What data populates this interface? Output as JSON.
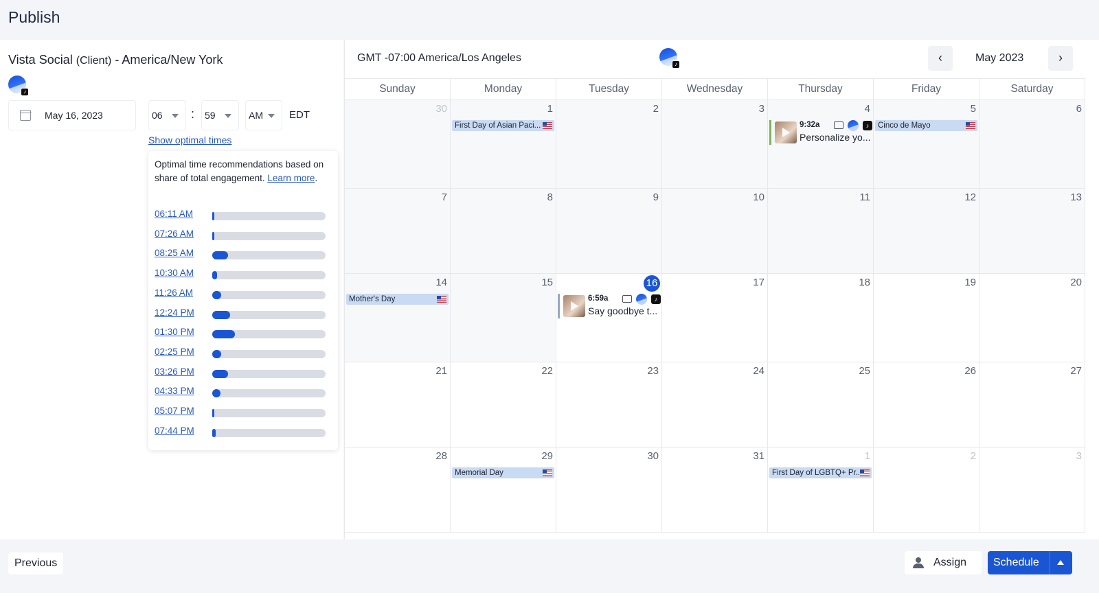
{
  "header": {
    "title": "Publish"
  },
  "left": {
    "account": "Vista Social",
    "account_tag": "(Client)",
    "account_tz": "- America/New York",
    "date": "May 16, 2023",
    "hour": "06",
    "minute": "59",
    "ampm": "AM",
    "tz_abbr": "EDT",
    "optimal_link": "Show optimal times",
    "popup": {
      "desc": "Optimal time recommendations based on share of total engagement.",
      "learn_more": "Learn more",
      "times": [
        {
          "label": "06:11 AM",
          "share": 0.01
        },
        {
          "label": "07:26 AM",
          "share": 0.02
        },
        {
          "label": "08:25 AM",
          "share": 0.14
        },
        {
          "label": "10:30 AM",
          "share": 0.04
        },
        {
          "label": "11:26 AM",
          "share": 0.08
        },
        {
          "label": "12:24 PM",
          "share": 0.16
        },
        {
          "label": "01:30 PM",
          "share": 0.2
        },
        {
          "label": "02:25 PM",
          "share": 0.08
        },
        {
          "label": "03:26 PM",
          "share": 0.14
        },
        {
          "label": "04:33 PM",
          "share": 0.07
        },
        {
          "label": "05:07 PM",
          "share": 0.02
        },
        {
          "label": "07:44 PM",
          "share": 0.03
        }
      ]
    }
  },
  "calendar": {
    "timezone": "GMT -07:00 America/Los Angeles",
    "month": "May 2023",
    "prev": "‹",
    "next": "›",
    "days": [
      "Sunday",
      "Monday",
      "Tuesday",
      "Wednesday",
      "Thursday",
      "Friday",
      "Saturday"
    ],
    "weeks": [
      [
        "30",
        "1",
        "2",
        "3",
        "4",
        "5",
        "6"
      ],
      [
        "7",
        "8",
        "9",
        "10",
        "11",
        "12",
        "13"
      ],
      [
        "14",
        "15",
        "16",
        "17",
        "18",
        "19",
        "20"
      ],
      [
        "21",
        "22",
        "23",
        "24",
        "25",
        "26",
        "27"
      ],
      [
        "28",
        "29",
        "30",
        "31",
        "1",
        "2",
        "3"
      ]
    ],
    "holidays": {
      "monday_1": "First Day of Asian Paci...",
      "friday_5": "Cinco de Mayo",
      "sunday_14": "Mother's Day",
      "monday_29": "Memorial Day",
      "thursday_1": "First Day of LGBTQ+ Pr..."
    },
    "posts": {
      "thursday_4": {
        "time": "9:32a",
        "text": "Personalize yo..."
      },
      "tuesday_16": {
        "time": "6:59a",
        "text": "Say goodbye t..."
      }
    }
  },
  "footer": {
    "previous": "Previous",
    "assign": "Assign",
    "schedule": "Schedule"
  }
}
